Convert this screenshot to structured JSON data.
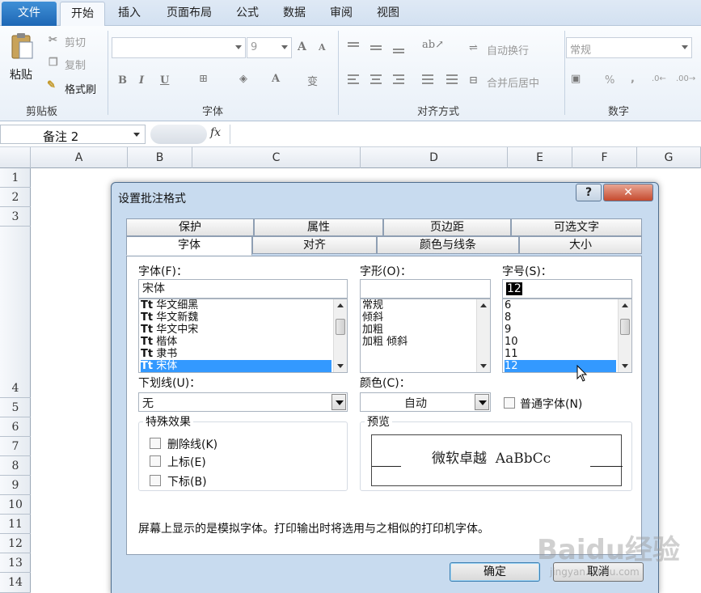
{
  "ribbon_tabs": [
    "文件",
    "开始",
    "插入",
    "页面布局",
    "公式",
    "数据",
    "审阅",
    "视图"
  ],
  "clipboard": {
    "paste": "粘贴",
    "cut": "剪切",
    "copy": "复制",
    "format_painter": "格式刷",
    "group": "剪贴板"
  },
  "font_group": {
    "size": "9",
    "group": "字体"
  },
  "align_group": {
    "wrap": "自动换行",
    "merge": "合并后居中",
    "group": "对齐方式"
  },
  "number_group": {
    "format": "常规",
    "group": "数字",
    "percent": "%",
    "comma": ",",
    "inc": ".0←",
    "dec": ".00→"
  },
  "formula_bar": {
    "name_box": "备注 2",
    "fx": "fx"
  },
  "columns": [
    "A",
    "B",
    "C",
    "D",
    "E",
    "F",
    "G"
  ],
  "rows": [
    "1",
    "2",
    "3",
    "4",
    "5",
    "6",
    "7",
    "8",
    "9",
    "10",
    "11",
    "12",
    "13",
    "14"
  ],
  "dialog": {
    "title": "设置批注格式",
    "help": "?",
    "tabs_back": [
      "保护",
      "属性",
      "页边距",
      "可选文字"
    ],
    "tabs_front": [
      "字体",
      "对齐",
      "颜色与线条",
      "大小"
    ],
    "font_label": "字体(F)：",
    "font_value": "宋体",
    "font_list": [
      "华文细黑",
      "华文新魏",
      "华文中宋",
      "楷体",
      "隶书",
      "宋体"
    ],
    "style_label": "字形(O)：",
    "style_value": "",
    "style_list": [
      "常规",
      "倾斜",
      "加粗",
      "加粗 倾斜"
    ],
    "size_label": "字号(S)：",
    "size_value": "12",
    "size_list": [
      "6",
      "8",
      "9",
      "10",
      "11",
      "12"
    ],
    "underline_label": "下划线(U)：",
    "underline_value": "无",
    "color_label": "颜色(C)：",
    "color_value": "自动",
    "normal_font": "普通字体(N)",
    "effects_title": "特殊效果",
    "strike": "删除线(K)",
    "superscript": "上标(E)",
    "subscript": "下标(B)",
    "preview_title": "预览",
    "preview_text": "微软卓越  AaBbCc",
    "note": "屏幕上显示的是模拟字体。打印输出时将选用与之相似的打印机字体。",
    "ok": "确定",
    "cancel": "取消"
  },
  "watermark": "Baidu经验",
  "watermark_sub": "jingyan.baidu.com"
}
